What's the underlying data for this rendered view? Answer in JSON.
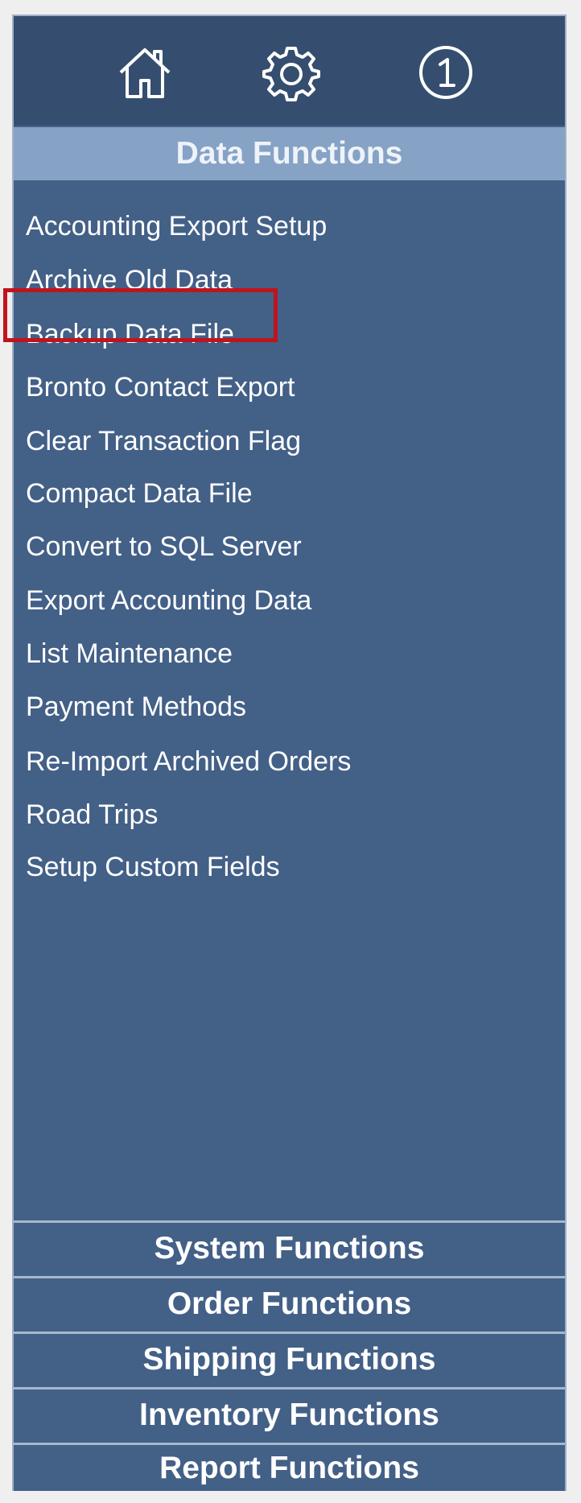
{
  "toolbar": {
    "icons": [
      "home-icon",
      "gear-icon",
      "info-icon"
    ]
  },
  "active_section": {
    "label": "Data Functions",
    "items": [
      {
        "label": "Accounting Export Setup"
      },
      {
        "label": "Archive Old Data"
      },
      {
        "label": "Backup Data File"
      },
      {
        "label": "Bronto Contact Export"
      },
      {
        "label": "Clear Transaction Flag"
      },
      {
        "label": "Compact Data File"
      },
      {
        "label": "Convert to SQL Server"
      },
      {
        "label": "Export Accounting Data"
      },
      {
        "label": "List Maintenance"
      },
      {
        "label": "Payment Methods"
      },
      {
        "label": "Re-Import Archived Orders"
      },
      {
        "label": "Road Trips"
      },
      {
        "label": "Setup Custom Fields"
      }
    ],
    "highlighted_item": "Backup Data File"
  },
  "sections": [
    {
      "label": "System Functions"
    },
    {
      "label": "Order Functions"
    },
    {
      "label": "Shipping Functions"
    },
    {
      "label": "Inventory Functions"
    },
    {
      "label": "Report Functions"
    }
  ],
  "colors": {
    "panel_bg": "#436087",
    "toolbar_bg": "#354e70",
    "active_header_bg": "#86a2c5",
    "highlight_border": "#c0141c"
  }
}
